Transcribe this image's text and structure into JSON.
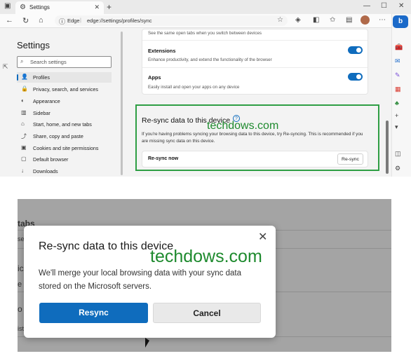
{
  "browser": {
    "tab_title": "Settings",
    "new_tab_glyph": "+",
    "window_controls": [
      "—",
      "☐",
      "✕"
    ],
    "address": {
      "site_label": "Edge",
      "separator": "|",
      "url": "edge://settings/profiles/sync"
    }
  },
  "settings": {
    "title": "Settings",
    "search_placeholder": "Search settings",
    "nav": [
      {
        "label": "Profiles",
        "icon": "person-icon",
        "active": true
      },
      {
        "label": "Privacy, search, and services",
        "icon": "lock-icon"
      },
      {
        "label": "Appearance",
        "icon": "appearance-icon"
      },
      {
        "label": "Sidebar",
        "icon": "sidebar-icon"
      },
      {
        "label": "Start, home, and new tabs",
        "icon": "home-icon"
      },
      {
        "label": "Share, copy and paste",
        "icon": "share-icon"
      },
      {
        "label": "Cookies and site permissions",
        "icon": "cookie-icon"
      },
      {
        "label": "Default browser",
        "icon": "browser-icon"
      },
      {
        "label": "Downloads",
        "icon": "download-icon"
      }
    ]
  },
  "sync": {
    "top_partial_text": "See the same open tabs when you switch between devices",
    "items": [
      {
        "title": "Extensions",
        "desc": "Enhance productivity, and extend the functionality of the browser",
        "enabled": true
      },
      {
        "title": "Apps",
        "desc": "Easily install and open your apps on any device",
        "enabled": true
      }
    ],
    "resync_heading": "Re-sync data to this device",
    "resync_desc": "If you're having problems syncing your browsing data to this device, try Re-syncing. This is recommended if you are missing sync data on this device.",
    "resync_now_label": "Re-sync now",
    "resync_button": "Re-sync"
  },
  "watermark": "techdows.com",
  "background_fragments": [
    "tabs",
    "se",
    "ic",
    "e",
    "o",
    "ist"
  ],
  "dialog": {
    "title": "Re-sync data to this device",
    "body": "We'll merge your local browsing data with your sync data stored on the Microsoft servers.",
    "primary": "Resync",
    "secondary": "Cancel",
    "close_glyph": "✕"
  },
  "colors": {
    "accent": "#0f6cbd",
    "highlight_frame": "#2e9e44",
    "watermark": "#1e8a2e"
  }
}
